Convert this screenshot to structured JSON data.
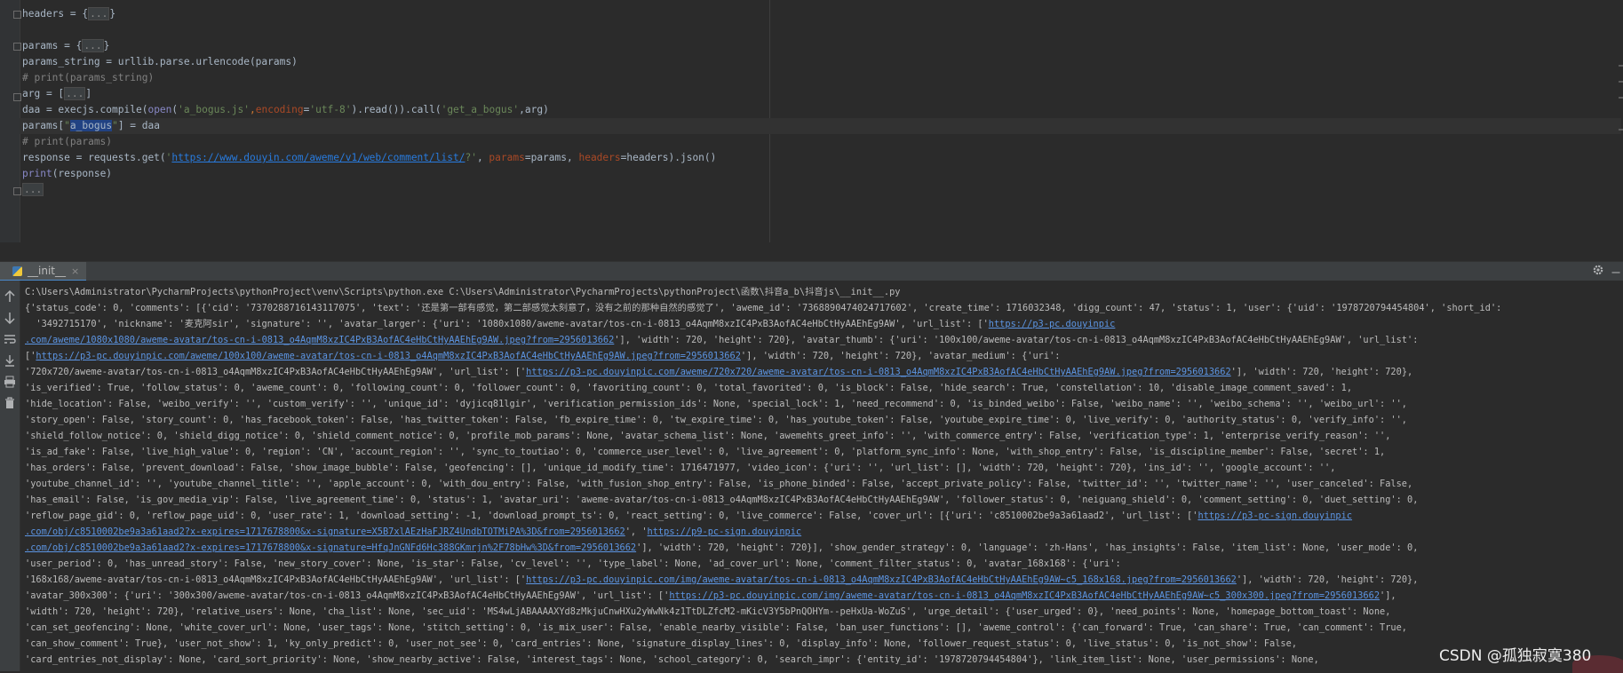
{
  "editor": {
    "lines": {
      "l1": "headers = {",
      "l1_fold": "...",
      "l1_end": "}",
      "l3": "params = {",
      "l3_fold": "...",
      "l3_end": "}",
      "l4": "params_string = urllib.parse.urlencode(params)",
      "l5": "# print(params_string)",
      "l6": "arg = [",
      "l6_fold": "...",
      "l6_end": "]",
      "l7_a": "daa = execjs.compile(",
      "l7_open": "open",
      "l7_b": "(",
      "l7_s1": "'a_bogus.js'",
      "l7_c": ",",
      "l7_enc": "encoding",
      "l7_eq": "=",
      "l7_s2": "'utf-8'",
      "l7_d": ").read()).call(",
      "l7_s3": "'get_a_bogus'",
      "l7_e": ",arg)",
      "l8_a": "params[",
      "l8_q1": "\"",
      "l8_hl": "a_bogus",
      "l8_q2": "\"",
      "l8_b": "] = daa",
      "l9": "# print(params)",
      "l10_a": "response = requests.get(",
      "l10_q1": "'",
      "l10_url": "https://www.douyin.com/aweme/v1/web/comment/list/",
      "l10_q2": "?'",
      "l10_c1": ", ",
      "l10_p": "params",
      "l10_c2": "=params, ",
      "l10_h": "headers",
      "l10_c3": "=headers).json()",
      "l11_print": "print",
      "l11_rest": "(response)",
      "l12_fold": "..."
    }
  },
  "run_panel": {
    "tab_label": "__init__",
    "tab_close": "×",
    "settings_icon": "gear-icon",
    "minimize_label": "–"
  },
  "console": {
    "lines": {
      "c1": "C:\\Users\\Administrator\\PycharmProjects\\pythonProject\\venv\\Scripts\\python.exe C:\\Users\\Administrator\\PycharmProjects\\pythonProject\\函数\\抖音a_b\\抖音js\\__init__.py",
      "c2": "{'status_code': 0, 'comments': [{'cid': '7370288716143117075', 'text': '还是第一部有感觉，第二部感觉太刻意了，没有之前的那种自然的感觉了', 'aweme_id': '7368890474024717602', 'create_time': 1716032348, 'digg_count': 47, 'status': 1, 'user': {'uid': '1978720794454804', 'short_id':",
      "c3": "  '3492715170', 'nickname': '麦克阿sir', 'signature': '', 'avatar_larger': {'uri': '1080x1080/aweme-avatar/tos-cn-i-0813_o4AqmM8xzIC4PxB3AofAC4eHbCtHyAAEhEg9AW', 'url_list': ['",
      "c3_url": "https://p3-pc.douyinpic",
      "c4_url": ".com/aweme/1080x1080/aweme-avatar/tos-cn-i-0813_o4AqmM8xzIC4PxB3AofAC4eHbCtHyAAEhEg9AW.jpeg?from=2956013662",
      "c4": "'], 'width': 720, 'height': 720}, 'avatar_thumb': {'uri': '100x100/aweme-avatar/tos-cn-i-0813_o4AqmM8xzIC4PxB3AofAC4eHbCtHyAAEhEg9AW', 'url_list':",
      "c5_a": "['",
      "c5_url": "https://p3-pc.douyinpic.com/aweme/100x100/aweme-avatar/tos-cn-i-0813_o4AqmM8xzIC4PxB3AofAC4eHbCtHyAAEhEg9AW.jpeg?from=2956013662",
      "c5_b": "'], 'width': 720, 'height': 720}, 'avatar_medium': {'uri':",
      "c6_a": "'720x720/aweme-avatar/tos-cn-i-0813_o4AqmM8xzIC4PxB3AofAC4eHbCtHyAAEhEg9AW', 'url_list': ['",
      "c6_url": "https://p3-pc.douyinpic.com/aweme/720x720/aweme-avatar/tos-cn-i-0813_o4AqmM8xzIC4PxB3AofAC4eHbCtHyAAEhEg9AW.jpeg?from=2956013662",
      "c6_b": "'], 'width': 720, 'height': 720},",
      "c7": "'is_verified': True, 'follow_status': 0, 'aweme_count': 0, 'following_count': 0, 'follower_count': 0, 'favoriting_count': 0, 'total_favorited': 0, 'is_block': False, 'hide_search': True, 'constellation': 10, 'disable_image_comment_saved': 1,",
      "c8": "'hide_location': False, 'weibo_verify': '', 'custom_verify': '', 'unique_id': 'dyjicq81lgir', 'verification_permission_ids': None, 'special_lock': 1, 'need_recommend': 0, 'is_binded_weibo': False, 'weibo_name': '', 'weibo_schema': '', 'weibo_url': '',",
      "c9": "'story_open': False, 'story_count': 0, 'has_facebook_token': False, 'has_twitter_token': False, 'fb_expire_time': 0, 'tw_expire_time': 0, 'has_youtube_token': False, 'youtube_expire_time': 0, 'live_verify': 0, 'authority_status': 0, 'verify_info': '',",
      "c10": "'shield_follow_notice': 0, 'shield_digg_notice': 0, 'shield_comment_notice': 0, 'profile_mob_params': None, 'avatar_schema_list': None, 'awemehts_greet_info': '', 'with_commerce_entry': False, 'verification_type': 1, 'enterprise_verify_reason': '',",
      "c11": "'is_ad_fake': False, 'live_high_value': 0, 'region': 'CN', 'account_region': '', 'sync_to_toutiao': 0, 'commerce_user_level': 0, 'live_agreement': 0, 'platform_sync_info': None, 'with_shop_entry': False, 'is_discipline_member': False, 'secret': 1,",
      "c12": "'has_orders': False, 'prevent_download': False, 'show_image_bubble': False, 'geofencing': [], 'unique_id_modify_time': 1716471977, 'video_icon': {'uri': '', 'url_list': [], 'width': 720, 'height': 720}, 'ins_id': '', 'google_account': '',",
      "c13": "'youtube_channel_id': '', 'youtube_channel_title': '', 'apple_account': 0, 'with_dou_entry': False, 'with_fusion_shop_entry': False, 'is_phone_binded': False, 'accept_private_policy': False, 'twitter_id': '', 'twitter_name': '', 'user_canceled': False,",
      "c14": "'has_email': False, 'is_gov_media_vip': False, 'live_agreement_time': 0, 'status': 1, 'avatar_uri': 'aweme-avatar/tos-cn-i-0813_o4AqmM8xzIC4PxB3AofAC4eHbCtHyAAEhEg9AW', 'follower_status': 0, 'neiguang_shield': 0, 'comment_setting': 0, 'duet_setting': 0,",
      "c15_a": "'reflow_page_gid': 0, 'reflow_page_uid': 0, 'user_rate': 1, 'download_setting': -1, 'download_prompt_ts': 0, 'react_setting': 0, 'live_commerce': False, 'cover_url': [{'uri': 'c8510002be9a3a61aad2', 'url_list': ['",
      "c15_url": "https://p3-pc-sign.douyinpic",
      "c16_url1": ".com/obj/c8510002be9a3a61aad2?x-expires=1717678800&x-signature=X5B7xlAEzHaFJRZ4UndbTOTMiPA%3D&from=2956013662",
      "c16_mid": "', '",
      "c16_url2": "https://p9-pc-sign.douyinpic",
      "c17_url": ".com/obj/c8510002be9a3a61aad2?x-expires=1717678800&x-signature=HfqJnGNFd6Hc388GKmrjn%2F78bHw%3D&from=2956013662",
      "c17_b": "'], 'width': 720, 'height': 720}], 'show_gender_strategy': 0, 'language': 'zh-Hans', 'has_insights': False, 'item_list': None, 'user_mode': 0,",
      "c18": "'user_period': 0, 'has_unread_story': False, 'new_story_cover': None, 'is_star': False, 'cv_level': '', 'type_label': None, 'ad_cover_url': None, 'comment_filter_status': 0, 'avatar_168x168': {'uri':",
      "c19_a": "'168x168/aweme-avatar/tos-cn-i-0813_o4AqmM8xzIC4PxB3AofAC4eHbCtHyAAEhEg9AW', 'url_list': ['",
      "c19_url": "https://p3-pc.douyinpic.com/img/aweme-avatar/tos-cn-i-0813_o4AqmM8xzIC4PxB3AofAC4eHbCtHyAAEhEg9AW~c5_168x168.jpeg?from=2956013662",
      "c19_b": "'], 'width': 720, 'height': 720},",
      "c20_a": "'avatar_300x300': {'uri': '300x300/aweme-avatar/tos-cn-i-0813_o4AqmM8xzIC4PxB3AofAC4eHbCtHyAAEhEg9AW', 'url_list': ['",
      "c20_url": "https://p3-pc.douyinpic.com/img/aweme-avatar/tos-cn-i-0813_o4AqmM8xzIC4PxB3AofAC4eHbCtHyAAEhEg9AW~c5_300x300.jpeg?from=2956013662",
      "c20_b": "'],",
      "c21": "'width': 720, 'height': 720}, 'relative_users': None, 'cha_list': None, 'sec_uid': 'MS4wLjABAAAAXYd8zMkjuCnwHXu2yWwNk4z1TtDLZfcM2-mKicV3Y5bPnQOHYm--peHxUa-WoZuS', 'urge_detail': {'user_urged': 0}, 'need_points': None, 'homepage_bottom_toast': None,",
      "c22": "'can_set_geofencing': None, 'white_cover_url': None, 'user_tags': None, 'stitch_setting': 0, 'is_mix_user': False, 'enable_nearby_visible': False, 'ban_user_functions': [], 'aweme_control': {'can_forward': True, 'can_share': True, 'can_comment': True,",
      "c23": "'can_show_comment': True}, 'user_not_show': 1, 'ky_only_predict': 0, 'user_not_see': 0, 'card_entries': None, 'signature_display_lines': 0, 'display_info': None, 'follower_request_status': 0, 'live_status': 0, 'is_not_show': False,",
      "c24": "'card_entries_not_display': None, 'card_sort_priority': None, 'show_nearby_active': False, 'interest_tags': None, 'school_category': 0, 'search_impr': {'entity_id': '1978720794454804'}, 'link_item_list': None, 'user_permissions': None,"
    },
    "watermark": "CSDN @孤独寂寞380"
  },
  "colors": {
    "background": "#2b2b2b",
    "keyword": "#cc7832",
    "string": "#6a8759",
    "comment": "#808080",
    "link": "#5c95e3",
    "selection": "#214283"
  }
}
